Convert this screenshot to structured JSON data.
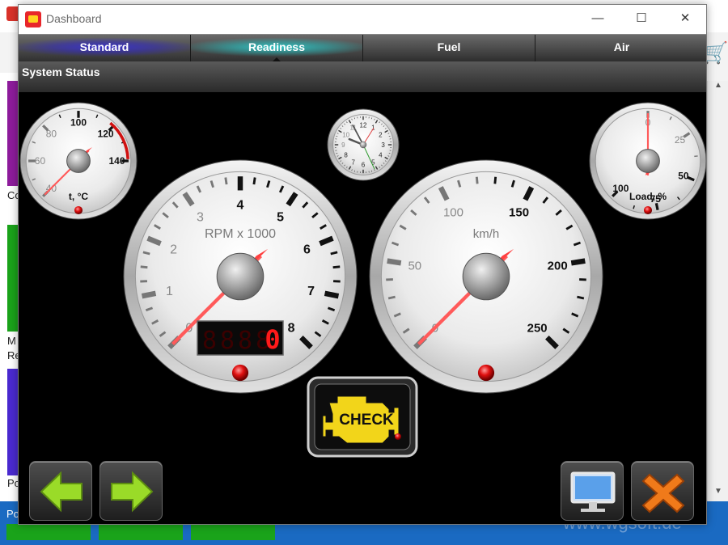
{
  "background_app": {
    "left_labels": [
      "Co",
      "M",
      "Re",
      "Po"
    ],
    "footer_text": "Po",
    "website": "www.wgsoft.de",
    "accent": "#1a6ac2",
    "bar_colors": [
      "#8e1c9c",
      "#1aa31a",
      "#4a2ad0"
    ]
  },
  "window": {
    "title": "Dashboard",
    "icon": "obd-app-icon",
    "controls": {
      "minimize": "—",
      "maximize": "☐",
      "close": "✕"
    }
  },
  "tabs": [
    {
      "label": "Standard",
      "highlight": "#3a33c8"
    },
    {
      "label": "Readiness",
      "highlight": "#2fc3c3",
      "selected": true
    },
    {
      "label": "Fuel"
    },
    {
      "label": "Air"
    }
  ],
  "section": {
    "title": "System Status"
  },
  "gauges": {
    "temp": {
      "label": "t, °C",
      "ticks": [
        "40",
        "60",
        "80",
        "100",
        "120",
        "140"
      ],
      "value": 40
    },
    "clock": {
      "numbers": [
        "12",
        "1",
        "2",
        "3",
        "4",
        "5",
        "6",
        "7",
        "8",
        "9",
        "10",
        "11"
      ]
    },
    "load": {
      "label": "Load, %",
      "ticks": [
        "0",
        "25",
        "50",
        "75",
        "100"
      ],
      "value": 0
    },
    "rpm": {
      "label": "RPM x 1000",
      "ticks": [
        "0",
        "1",
        "2",
        "3",
        "4",
        "5",
        "6",
        "7",
        "8"
      ],
      "value": 0,
      "digital": "0"
    },
    "speed": {
      "label": "km/h",
      "ticks": [
        "0",
        "50",
        "100",
        "150",
        "200",
        "250"
      ],
      "value": 0
    }
  },
  "check_engine": {
    "label": "CHECK",
    "color": "#f2d51a"
  },
  "buttons": {
    "back": "arrow-left-icon",
    "forward": "arrow-right-icon",
    "display": "monitor-icon",
    "close": "close-x-icon"
  }
}
